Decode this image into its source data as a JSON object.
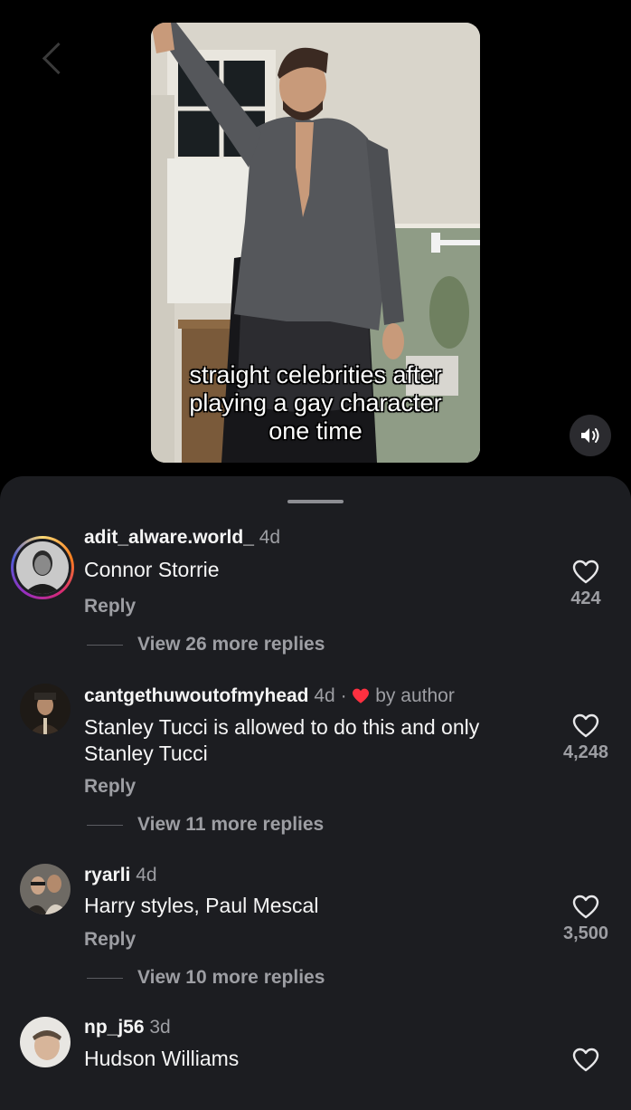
{
  "video": {
    "caption_lines": [
      "straight celebrities after",
      "playing a gay character",
      "one time"
    ],
    "mute_icon": "speaker-icon"
  },
  "comments": [
    {
      "username": "adit_alware.world_",
      "time": "4d",
      "text": "Connor Storrie",
      "reply_label": "Reply",
      "likes": "424",
      "view_replies": "View 26 more replies",
      "has_story_ring": true
    },
    {
      "username": "cantgethuwoutofmyhead",
      "time": "4d",
      "separator": "·",
      "liked_by": "by author",
      "text": "Stanley Tucci is allowed to do this and only Stanley Tucci",
      "reply_label": "Reply",
      "likes": "4,248",
      "view_replies": "View 11 more replies"
    },
    {
      "username": "ryarli",
      "time": "4d",
      "text": "Harry styles, Paul Mescal",
      "reply_label": "Reply",
      "likes": "3,500",
      "view_replies": "View 10 more replies"
    },
    {
      "username": "np_j56",
      "time": "3d",
      "text": "Hudson Williams"
    }
  ],
  "colors": {
    "sheet_bg": "#1c1d21",
    "heart_red": "#ff3040",
    "muted_text": "#9d9ea3"
  }
}
